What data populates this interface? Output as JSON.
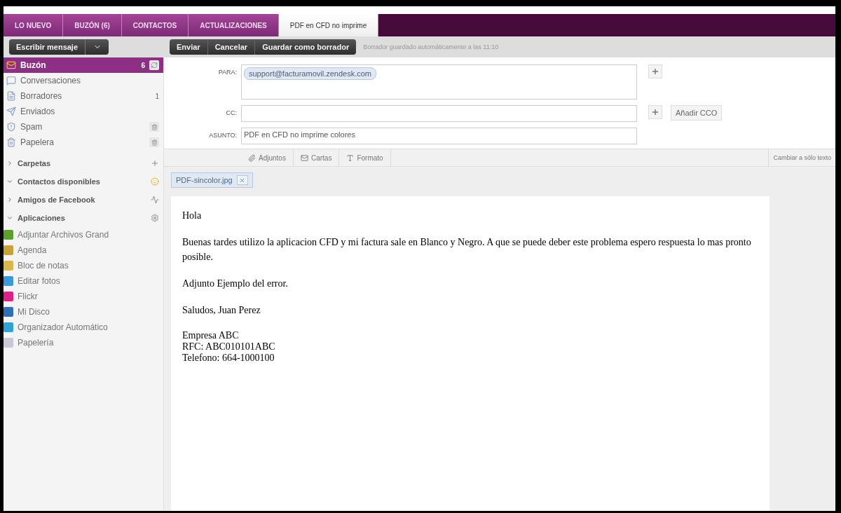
{
  "tabs": [
    {
      "label": "LO NUEVO",
      "selected": false
    },
    {
      "label": "BUZÓN (6)",
      "selected": false
    },
    {
      "label": "CONTACTOS",
      "selected": false
    },
    {
      "label": "ACTUALIZACIONES",
      "selected": false
    },
    {
      "label": "PDF en CFD no imprime",
      "selected": true
    }
  ],
  "compose_button": {
    "label": "Escribir mensaje"
  },
  "toolbar": {
    "buttons": [
      "Enviar",
      "Cancelar",
      "Guardar como borrador"
    ],
    "status": "Borrador guardado automáticamente a las 11:10"
  },
  "sidebar": {
    "folders": [
      {
        "label": "Buzón",
        "count": "6",
        "selected": true,
        "kind": "refreshable"
      },
      {
        "label": "Conversaciones",
        "selected": false,
        "kind": "plain"
      },
      {
        "label": "Borradores",
        "count": "1",
        "selected": false,
        "kind": "plain"
      },
      {
        "label": "Enviados",
        "selected": false,
        "kind": "plain"
      },
      {
        "label": "Spam",
        "selected": false,
        "kind": "clearable"
      },
      {
        "label": "Papelera",
        "selected": false,
        "kind": "clearable"
      }
    ],
    "sections": [
      {
        "label": "Carpetas",
        "expanded": false
      },
      {
        "label": "Contactos disponibles",
        "expanded": true
      },
      {
        "label": "Amigos de Facebook",
        "expanded": false
      },
      {
        "label": "Aplicaciones",
        "expanded": true
      }
    ],
    "apps": [
      {
        "label": "Adjuntar Archivos Grand",
        "color": "#5aa02c"
      },
      {
        "label": "Agenda",
        "color": "#c9a13a"
      },
      {
        "label": "Bloc de notas",
        "color": "#d9b74a"
      },
      {
        "label": "Editar fotos",
        "color": "#3a9ad9"
      },
      {
        "label": "Flickr",
        "color": "#e0208a"
      },
      {
        "label": "Mi Disco",
        "color": "#2f6fb5"
      },
      {
        "label": "Organizador Automático",
        "color": "#2ea3d6"
      },
      {
        "label": "Papelería",
        "color": "#c8c8d8"
      }
    ]
  },
  "compose": {
    "to_label": "PARA:",
    "to": [
      "support@facturamovil.zendesk.com"
    ],
    "cc_label": "CC:",
    "add_bcc": "Añadir CCO",
    "subject_label": "ASUNTO:",
    "subject": "PDF en CFD no imprime colores",
    "format_tools": [
      "Adjuntos",
      "Cartas",
      "Formato"
    ],
    "plain_text": "Cambiar a sólo texto",
    "attachments": [
      "PDF-sincolor.jpg"
    ],
    "body": [
      "Hola",
      "Buenas tardes utilizo la aplicacion CFD y mi factura sale en Blanco y Negro. A que se puede deber este problema espero respuesta lo mas pronto posible.",
      "Adjunto Ejemplo del error.",
      "Saludos, Juan Perez",
      [
        "Empresa ABC",
        "RFC: ABC010101ABC",
        "Telefono: 664-1000100"
      ]
    ]
  }
}
